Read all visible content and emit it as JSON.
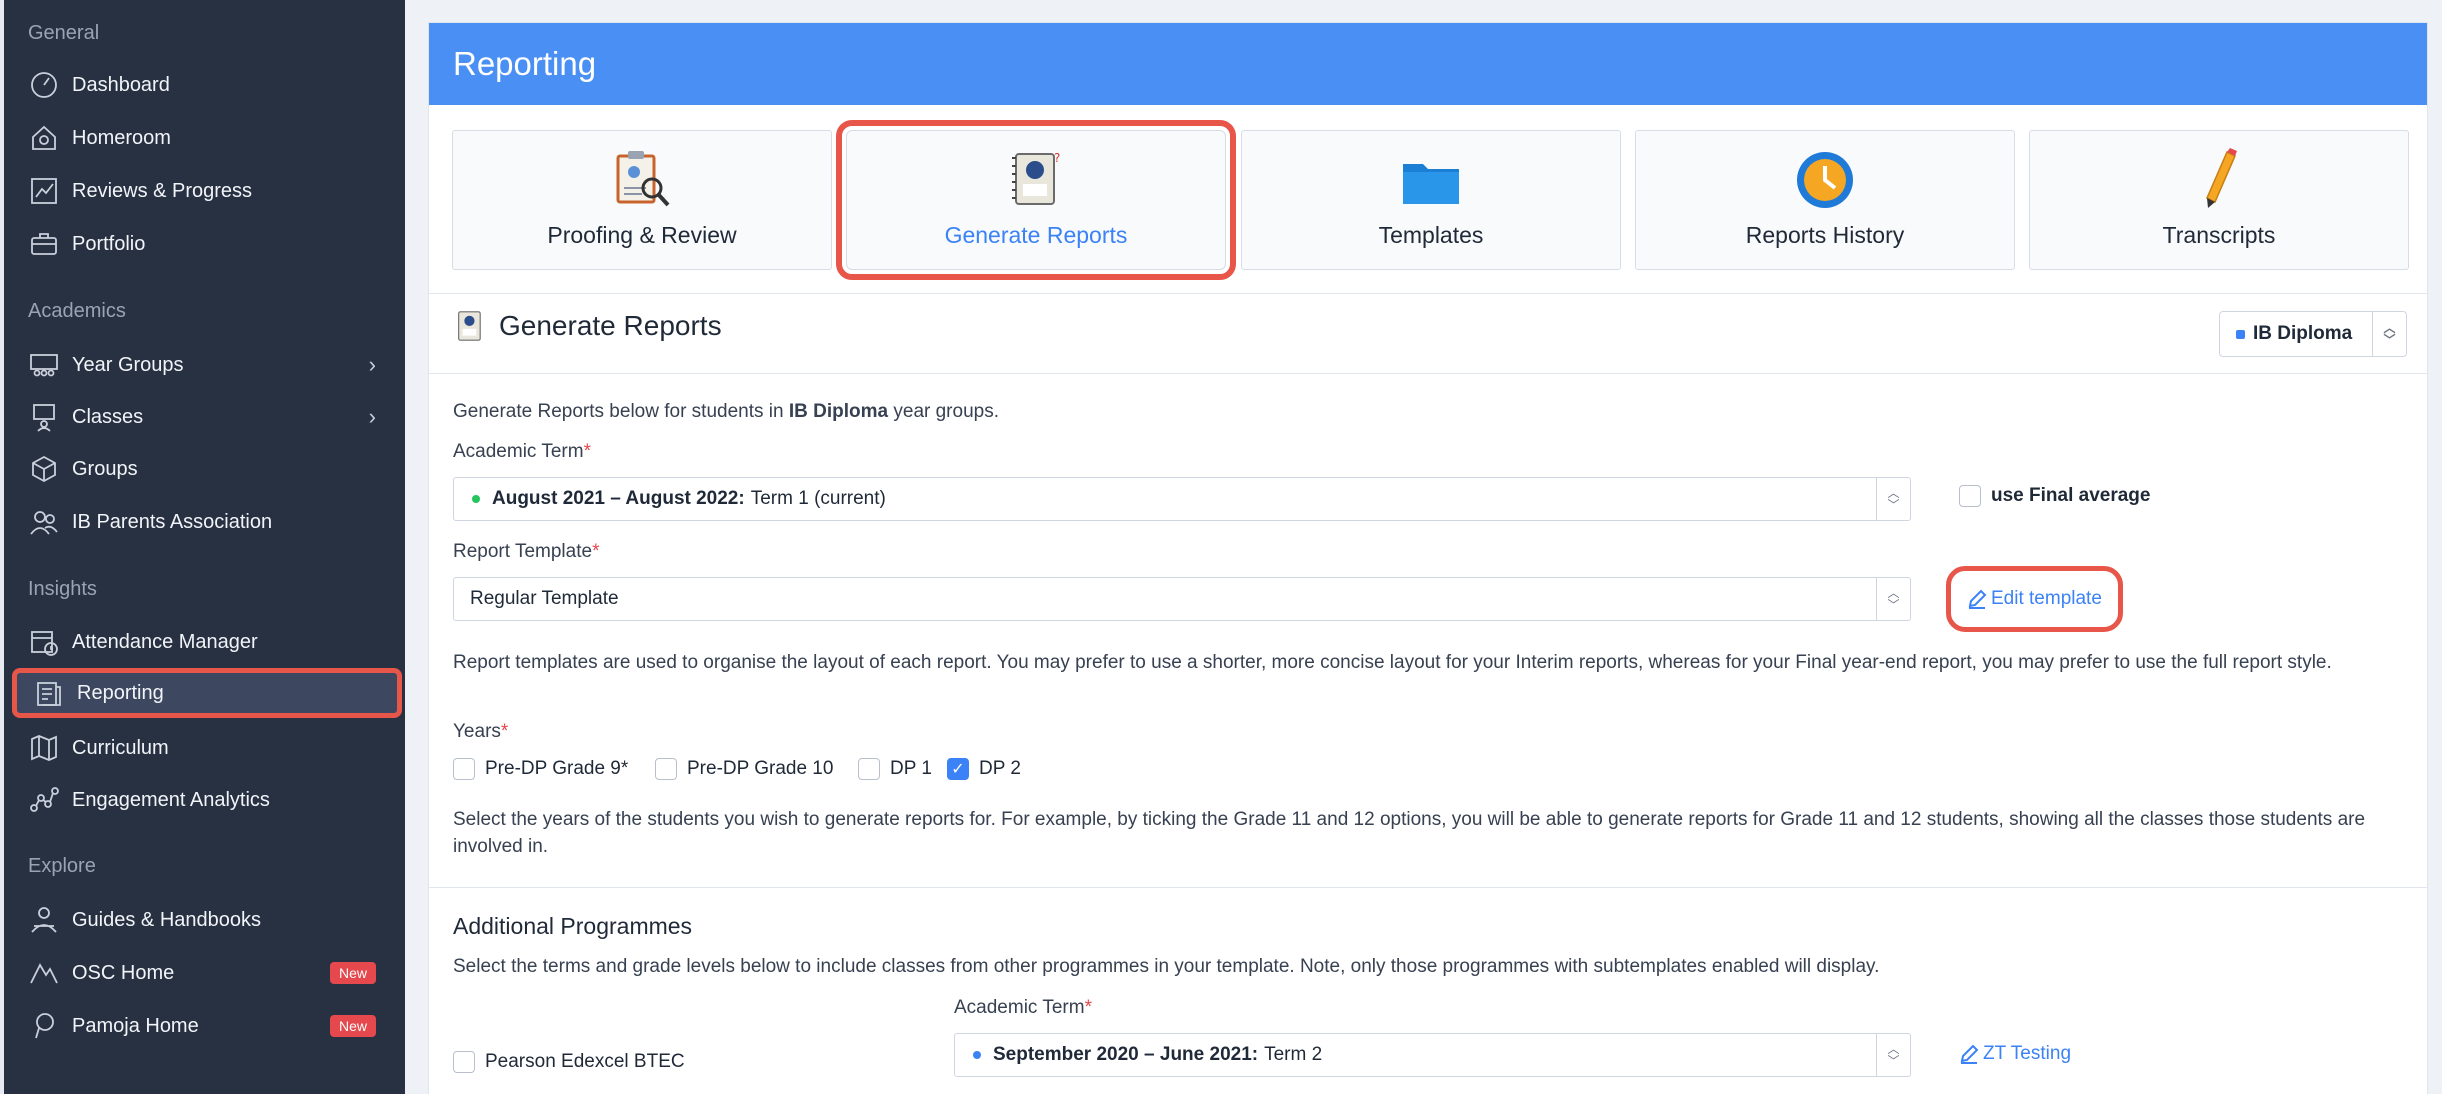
{
  "sidebar": {
    "sections": {
      "general": "General",
      "academics": "Academics",
      "insights": "Insights",
      "explore": "Explore"
    },
    "items": {
      "dashboard": "Dashboard",
      "homeroom": "Homeroom",
      "reviews": "Reviews & Progress",
      "portfolio": "Portfolio",
      "year_groups": "Year Groups",
      "classes": "Classes",
      "groups": "Groups",
      "parents": "IB Parents Association",
      "attendance": "Attendance Manager",
      "reporting": "Reporting",
      "curriculum": "Curriculum",
      "engagement": "Engagement Analytics",
      "guides": "Guides & Handbooks",
      "osc": "OSC Home",
      "pamoja": "Pamoja Home"
    },
    "new_badge": "New"
  },
  "banner": {
    "title": "Reporting"
  },
  "tiles": {
    "proofing": "Proofing & Review",
    "generate": "Generate Reports",
    "templates": "Templates",
    "history": "Reports History",
    "transcripts": "Transcripts"
  },
  "generate": {
    "heading": "Generate Reports",
    "programme": "IB Diploma",
    "intro_prefix": "Generate Reports below for students in ",
    "intro_bold": "IB Diploma",
    "intro_suffix": " year groups.",
    "term_label": "Academic Term",
    "term_bold": "August 2021 – August 2022:",
    "term_value": "Term 1 (current)",
    "final_avg": "use Final average",
    "template_label": "Report Template",
    "template_value": "Regular Template",
    "edit_template": "Edit template",
    "template_help": "Report templates are used to organise the layout of each report. You may prefer to use a shorter, more concise layout for your Interim reports, whereas for your Final year-end report, you may prefer to use the full report style.",
    "years_label": "Years",
    "years": [
      "Pre-DP Grade 9*",
      "Pre-DP Grade 10",
      "DP 1",
      "DP 2"
    ],
    "years_help": "Select the years of the students you wish to generate reports for. For example, by ticking the Grade 11 and 12 options, you will be able to generate reports for Grade 11 and 12 students, showing all the classes those students are involved in."
  },
  "additional": {
    "heading": "Additional Programmes",
    "help": "Select the terms and grade levels below to include classes from other programmes in your template. Note, only those programmes with subtemplates enabled will display.",
    "programme": "Pearson Edexcel BTEC",
    "term_label": "Academic Term",
    "term_bold": "September 2020 – June 2021:",
    "term_value": "Term 2",
    "link": "ZT Testing"
  },
  "colors": {
    "accent": "#4a8ff3",
    "highlight": "#e8564a",
    "sidebar": "#283142",
    "badge": "#e5484d"
  }
}
